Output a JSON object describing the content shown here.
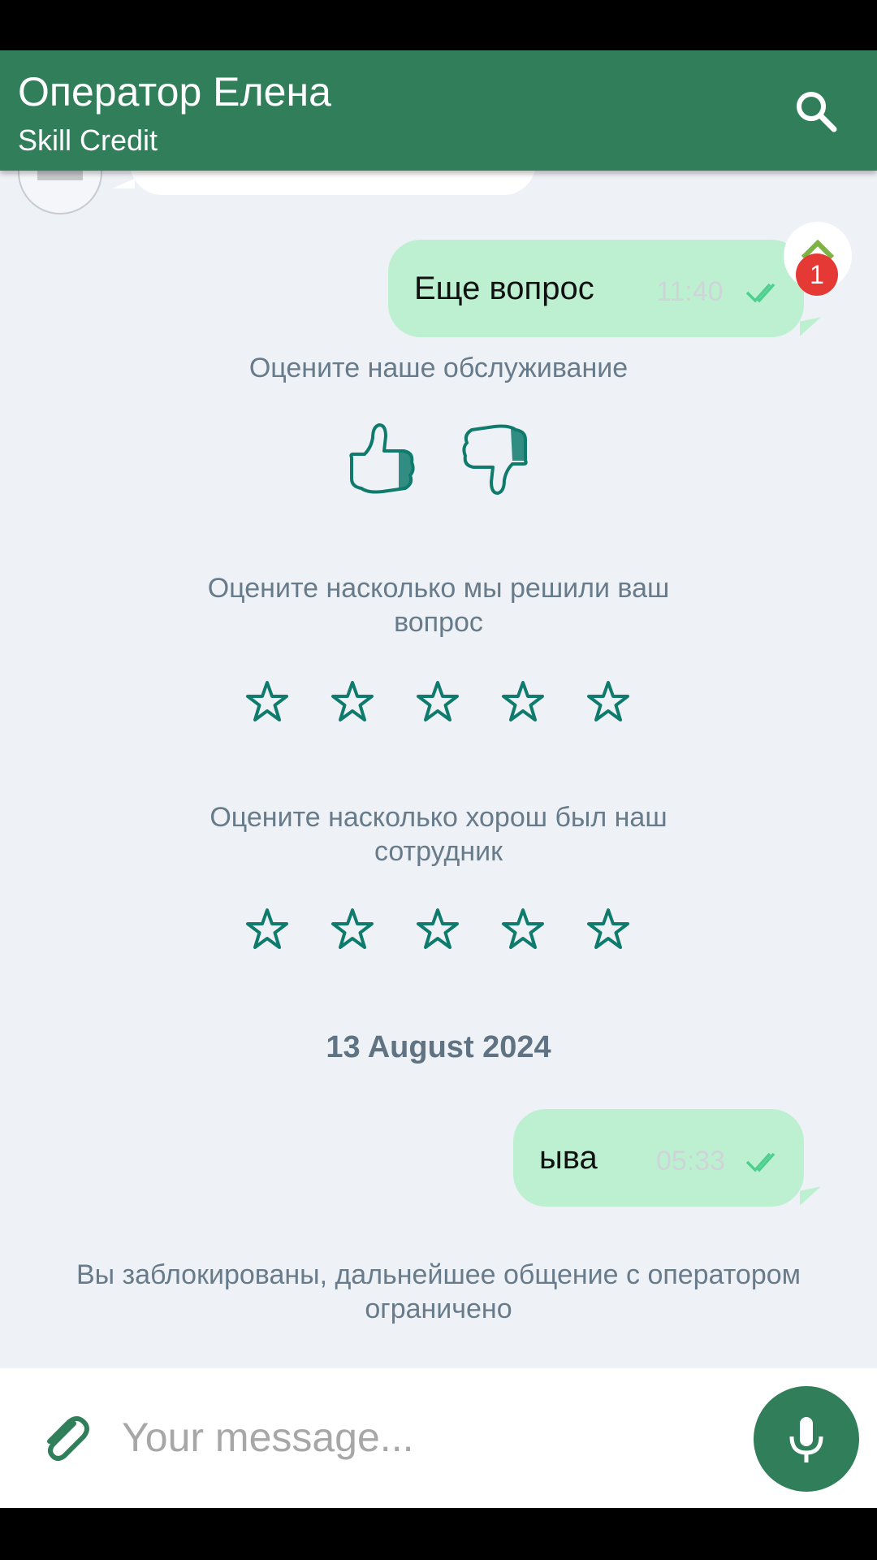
{
  "header": {
    "title": "Оператор Елена",
    "subtitle": "Skill Credit",
    "search_icon": "search-icon"
  },
  "messages": [
    {
      "text": "Еще вопрос",
      "time": "11:40",
      "status_icon": "double-check-icon"
    },
    {
      "text": "ыва",
      "time": "05:33",
      "status_icon": "double-check-icon"
    }
  ],
  "scroll_badge": {
    "count": "1",
    "icon": "arrow-up-icon"
  },
  "rating": {
    "service_title": "Оцените наше обслуживание",
    "like_icon": "thumbs-up-icon",
    "dislike_icon": "thumbs-down-icon",
    "resolution_title_line1": "Оцените насколько мы решили ваш",
    "resolution_title_line2": "вопрос",
    "employee_title_line1": "Оцените насколько хорош был наш",
    "employee_title_line2": "сотрудник",
    "stars_count": 5,
    "resolution_value": 0,
    "employee_value": 0
  },
  "date_separator": "13 August 2024",
  "blocked_notice_line1": "Вы заблокированы, дальнейшее общение с оператором",
  "blocked_notice_line2": "ограничено",
  "composer": {
    "placeholder": "Your message...",
    "attach_icon": "paperclip-icon",
    "mic_icon": "microphone-icon"
  },
  "colors": {
    "primary": "#317f5a",
    "bubble": "#bdf0d1",
    "background": "#eef1f6",
    "accent_teal": "#0f7b6c",
    "badge": "#e53935"
  }
}
